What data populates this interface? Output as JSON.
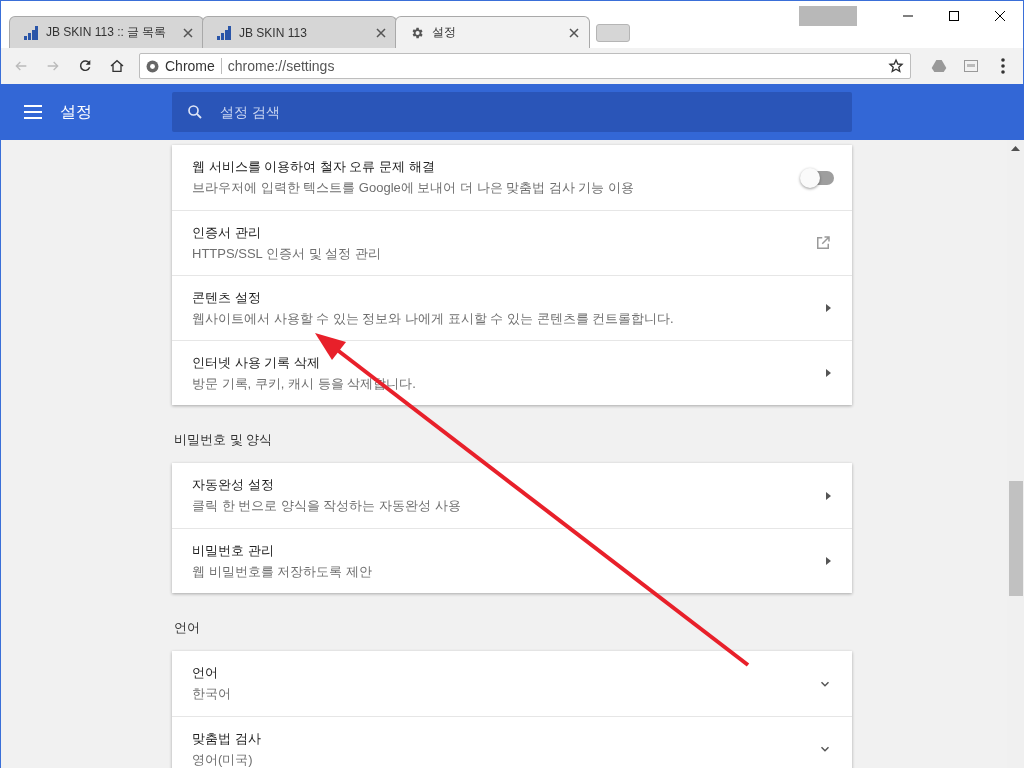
{
  "tabs": [
    {
      "label": "JB SKIN 113 :: 글 목록",
      "kind": "blog",
      "selected": false
    },
    {
      "label": "JB SKIN 113",
      "kind": "blog",
      "selected": false
    },
    {
      "label": "설정",
      "kind": "settings",
      "selected": true
    }
  ],
  "toolbar": {
    "site": "Chrome",
    "url": "chrome://settings"
  },
  "header": {
    "title": "설정",
    "search_placeholder": "설정 검색"
  },
  "sections": [
    {
      "rows": [
        {
          "title": "웹 서비스를 이용하여 철자 오류 문제 해결",
          "subtitle": "브라우저에 입력한 텍스트를 Google에 보내어 더 나은 맞춤법 검사 기능 이용",
          "kind": "toggle",
          "on": false
        },
        {
          "title": "인증서 관리",
          "subtitle": "HTTPS/SSL 인증서 및 설정 관리",
          "kind": "external"
        },
        {
          "title": "콘텐츠 설정",
          "subtitle": "웹사이트에서 사용할 수 있는 정보와 나에게 표시할 수 있는 콘텐츠를 컨트롤합니다.",
          "kind": "arrow"
        },
        {
          "title": "인터넷 사용 기록 삭제",
          "subtitle": "방문 기록, 쿠키, 캐시 등을 삭제합니다.",
          "kind": "arrow"
        }
      ]
    },
    {
      "title": "비밀번호 및 양식",
      "rows": [
        {
          "title": "자동완성 설정",
          "subtitle": "클릭 한 번으로 양식을 작성하는 자동완성 사용",
          "kind": "arrow"
        },
        {
          "title": "비밀번호 관리",
          "subtitle": "웹 비밀번호를 저장하도록 제안",
          "kind": "arrow"
        }
      ]
    },
    {
      "title": "언어",
      "rows": [
        {
          "title": "언어",
          "subtitle": "한국어",
          "kind": "expand"
        },
        {
          "title": "맞춤법 검사",
          "subtitle": "영어(미국)",
          "kind": "expand"
        }
      ]
    }
  ]
}
